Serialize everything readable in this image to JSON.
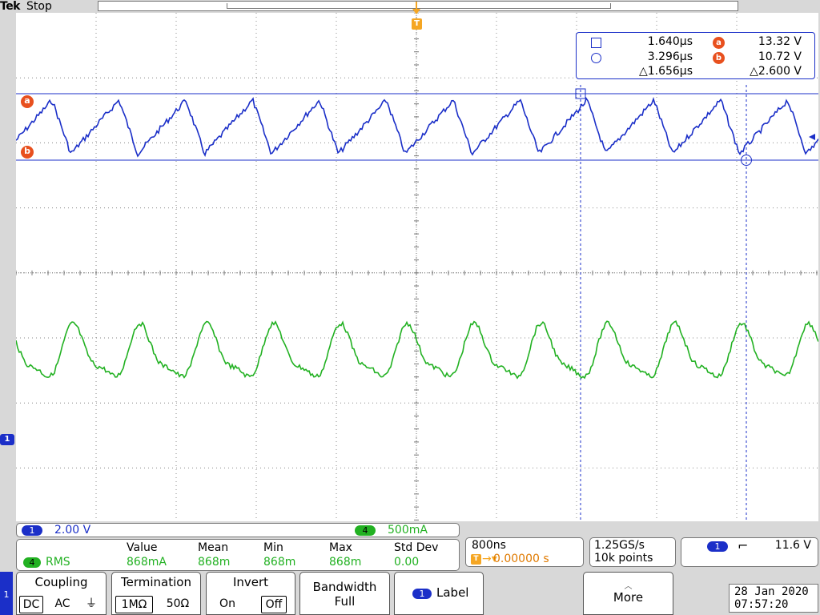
{
  "header": {
    "brand": "Tek",
    "run_state": "Stop"
  },
  "markers": {
    "a": "a",
    "b": "b",
    "trigger": "T",
    "ch1_ground": "1",
    "left_strip": "1"
  },
  "cursors": {
    "t1": "1.640µs",
    "t2": "3.296µs",
    "dt": "△1.656µs",
    "a_label": "a",
    "b_label": "b",
    "va": "13.32 V",
    "vb": "10.72 V",
    "dv": "△2.600 V"
  },
  "channels": {
    "ch1": {
      "badge": "1",
      "scale": "2.00 V",
      "color": "#1b2fc8"
    },
    "ch4": {
      "badge": "4",
      "scale": "500mA",
      "color": "#22b122"
    }
  },
  "measurement": {
    "channel": "4",
    "type": "RMS",
    "headers": [
      "Value",
      "Mean",
      "Min",
      "Max",
      "Std Dev"
    ],
    "values": [
      "868mA",
      "868m",
      "868m",
      "868m",
      "0.00"
    ]
  },
  "timebase": {
    "per_div": "800ns",
    "trigger_badge": "T",
    "trigger_arrow": "→▾",
    "position": "0.00000 s"
  },
  "acquisition": {
    "sample_rate": "1.25GS/s",
    "record_length": "10k points"
  },
  "trigger": {
    "source": "1",
    "slope": "⌐",
    "level": "11.6 V"
  },
  "menu": {
    "coupling": {
      "title": "Coupling",
      "options": [
        "DC",
        "AC",
        "⏚"
      ]
    },
    "termination": {
      "title": "Termination",
      "options": [
        "1MΩ",
        "50Ω"
      ]
    },
    "invert": {
      "title": "Invert",
      "options": [
        "On",
        "Off"
      ]
    },
    "bandwidth": {
      "title": "Bandwidth",
      "value": "Full"
    },
    "label": {
      "badge": "1",
      "title": "Label"
    },
    "more": {
      "arrow": "︿",
      "title": "More"
    }
  },
  "datetime": {
    "date": "28 Jan 2020",
    "time": "07:57:20"
  },
  "waveforms": {
    "ch1": {
      "shape": "sawtooth",
      "cycles": 12,
      "high_v": 13.32,
      "low_v": 10.72
    },
    "ch4": {
      "shape": "sine",
      "cycles": 12
    }
  }
}
